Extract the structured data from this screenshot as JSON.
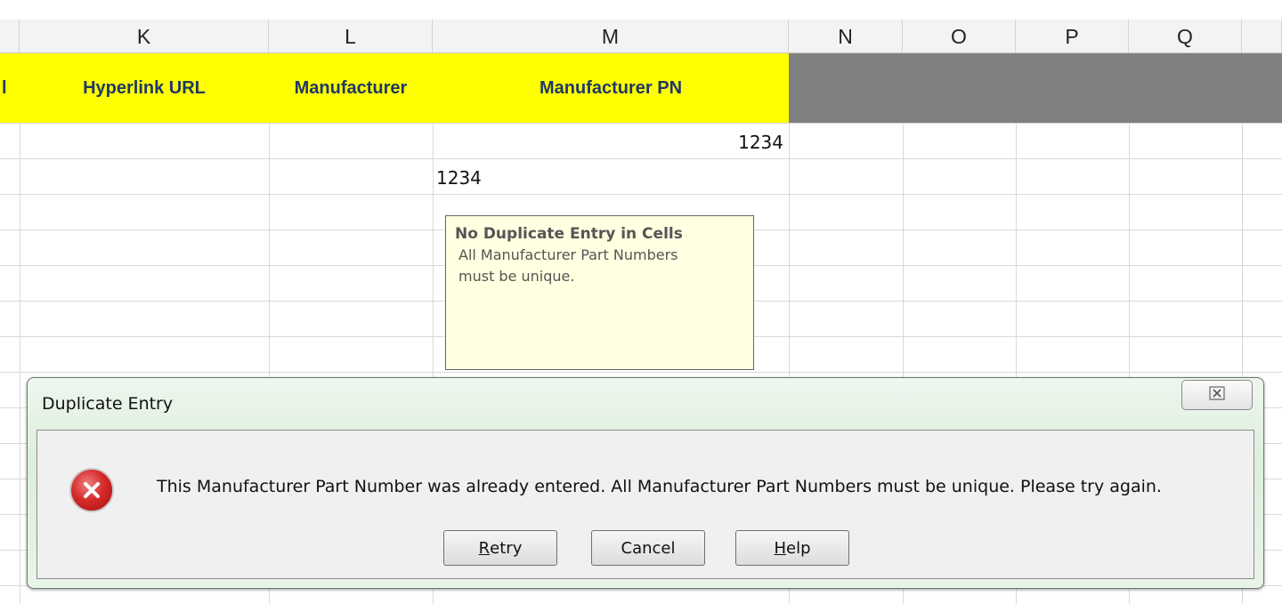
{
  "columns": {
    "partial_left": "",
    "K": "K",
    "L": "L",
    "M": "M",
    "N": "N",
    "O": "O",
    "P": "P",
    "Q": "Q"
  },
  "header_row": {
    "partial_left": "l",
    "hyperlink_url": "Hyperlink URL",
    "manufacturer": "Manufacturer",
    "manufacturer_pn": "Manufacturer PN"
  },
  "cells": {
    "m_row1": "1234",
    "m_row2": "1234"
  },
  "note": {
    "title": "No Duplicate Entry in Cells",
    "line1": "All Manufacturer Part Numbers",
    "line2": "must be unique."
  },
  "dialog": {
    "title": "Duplicate Entry",
    "close_glyph": "☒",
    "message": "This Manufacturer Part Number was already entered.  All Manufacturer Part Numbers must be unique.  Please try again.",
    "error_icon": "error-x-icon",
    "buttons": {
      "retry_first": "R",
      "retry_rest": "etry",
      "cancel": "Cancel",
      "help_first": "H",
      "help_rest": "elp"
    }
  },
  "colors": {
    "header_fill": "#ffff00",
    "grey_fill": "#808080",
    "note_fill": "#ffffe1",
    "error_red": "#d62b2b"
  }
}
